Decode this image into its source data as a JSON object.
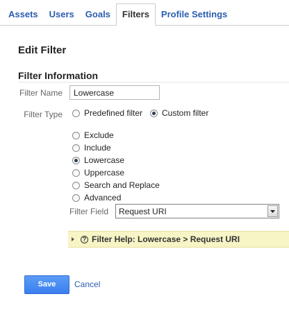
{
  "tabs": [
    {
      "label": "Assets",
      "active": false
    },
    {
      "label": "Users",
      "active": false
    },
    {
      "label": "Goals",
      "active": false
    },
    {
      "label": "Filters",
      "active": true
    },
    {
      "label": "Profile Settings",
      "active": false
    }
  ],
  "page_title": "Edit Filter",
  "section_title": "Filter Information",
  "filter_name": {
    "label": "Filter Name",
    "value": "Lowercase"
  },
  "filter_type": {
    "label": "Filter Type",
    "options": [
      {
        "label": "Predefined filter",
        "checked": false
      },
      {
        "label": "Custom filter",
        "checked": true
      }
    ]
  },
  "custom_options": [
    {
      "label": "Exclude",
      "checked": false
    },
    {
      "label": "Include",
      "checked": false
    },
    {
      "label": "Lowercase",
      "checked": true
    },
    {
      "label": "Uppercase",
      "checked": false
    },
    {
      "label": "Search and Replace",
      "checked": false
    },
    {
      "label": "Advanced",
      "checked": false
    }
  ],
  "filter_field": {
    "label": "Filter Field",
    "selected": "Request URI"
  },
  "help": {
    "icon": "question-circle-icon",
    "text": "Filter Help: Lowercase  >  Request URI"
  },
  "actions": {
    "save_label": "Save",
    "cancel_label": "Cancel"
  },
  "colors": {
    "link": "#2a5db0",
    "save_button": "#4a8af4",
    "help_background": "#f7f4c5"
  }
}
